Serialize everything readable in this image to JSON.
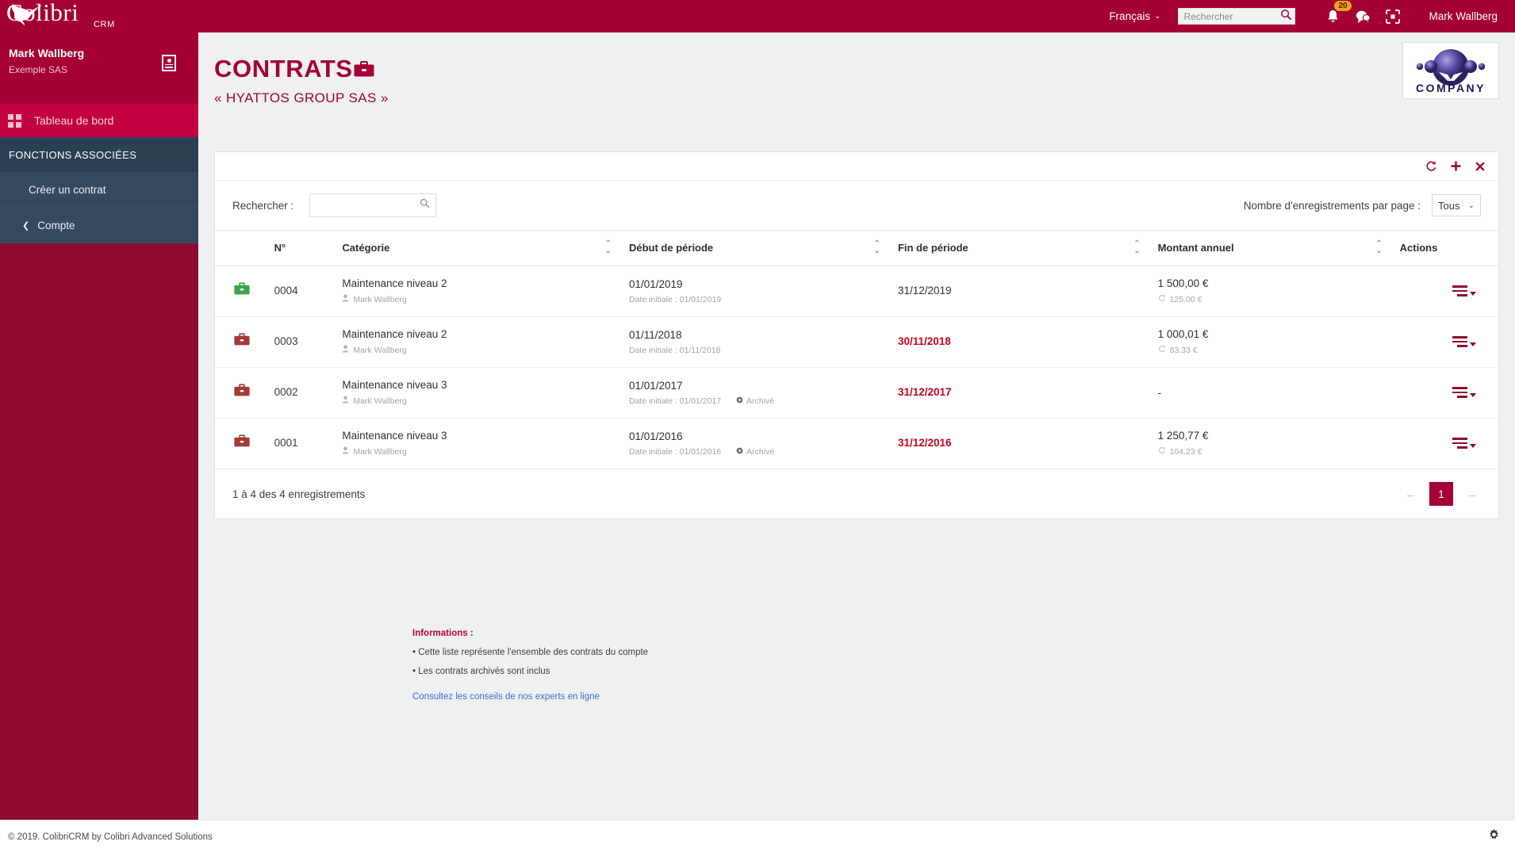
{
  "topbar": {
    "brand_name": "Colibri",
    "brand_sub": "CRM",
    "language": "Français",
    "search_placeholder": "Rechercher",
    "search_value": "",
    "notification_count": "20",
    "user_name": "Mark Wallberg",
    "icons": {
      "bell": "bell-icon",
      "chat": "chat-icon",
      "fullscreen": "fullscreen-icon",
      "search": "search-icon",
      "chevron": "chevron-down-icon"
    }
  },
  "sidebar": {
    "user_name": "Mark Wallberg",
    "user_org": "Exemple SAS",
    "dashboard_label": "Tableau de bord",
    "section_label": "FONCTIONS ASSOCIÉES",
    "items": [
      {
        "label": "Créer un contrat"
      },
      {
        "label": "Compte"
      }
    ]
  },
  "page": {
    "title": "CONTRATS",
    "subtitle": "« HYATTOS GROUP SAS »",
    "logo_text": "COMPANY"
  },
  "toolbar": {
    "refresh_label": "refresh-icon",
    "add_label": "add-icon",
    "close_label": "close-icon"
  },
  "filters": {
    "search_label": "Rechercher :",
    "search_value": "",
    "search_placeholder": "",
    "per_page_label": "Nombre d'enregistrements par page :",
    "per_page_value": "Tous",
    "per_page_options": [
      "Tous"
    ]
  },
  "table": {
    "columns": [
      {
        "key": "icon",
        "label": ""
      },
      {
        "key": "num",
        "label": "N°"
      },
      {
        "key": "category",
        "label": "Catégorie"
      },
      {
        "key": "start",
        "label": "Début de période"
      },
      {
        "key": "end",
        "label": "Fin de période"
      },
      {
        "key": "amount",
        "label": "Montant annuel"
      },
      {
        "key": "actions",
        "label": "Actions"
      }
    ],
    "rows": [
      {
        "icon_color": "#3fa34a",
        "num": "0004",
        "category": "Maintenance niveau 2",
        "owner": "Mark Wallberg",
        "start": "01/01/2019",
        "start_initial": "Date initiale : 01/01/2019",
        "archived": "",
        "end": "31/12/2019",
        "end_expired": false,
        "amount": "1 500,00 €",
        "amount_sub": "125.00 €"
      },
      {
        "icon_color": "#a33a3a",
        "num": "0003",
        "category": "Maintenance niveau 2",
        "owner": "Mark Wallberg",
        "start": "01/11/2018",
        "start_initial": "Date initiale : 01/11/2018",
        "archived": "",
        "end": "30/11/2018",
        "end_expired": true,
        "amount": "1 000,01 €",
        "amount_sub": "83.33 €"
      },
      {
        "icon_color": "#a33a3a",
        "num": "0002",
        "category": "Maintenance niveau 3",
        "owner": "Mark Wallberg",
        "start": "01/01/2017",
        "start_initial": "Date initiale : 01/01/2017",
        "archived": "Archivé",
        "end": "31/12/2017",
        "end_expired": true,
        "amount": "-",
        "amount_sub": ""
      },
      {
        "icon_color": "#a33a3a",
        "num": "0001",
        "category": "Maintenance niveau 3",
        "owner": "Mark Wallberg",
        "start": "01/01/2016",
        "start_initial": "Date initiale : 01/01/2016",
        "archived": "Archivé",
        "end": "31/12/2016",
        "end_expired": true,
        "amount": "1 250,77 €",
        "amount_sub": "104.23 €"
      }
    ]
  },
  "pagination": {
    "count_text": "1 à 4 des 4 enregistrements",
    "prev": "←",
    "page": "1",
    "next": "→"
  },
  "info": {
    "title": "Informations :",
    "lines": [
      "• Cette liste représente l'ensemble des contrats du compte",
      "• Les contrats archivés sont inclus"
    ],
    "link": "Consultez les conseils de nos experts en ligne"
  },
  "footer": {
    "copyright": "© 2019. ColibriCRM by Colibri Advanced Solutions",
    "gear": "gear-icon"
  },
  "colors": {
    "brand": "#a50034",
    "brand_dark": "#8f0b2f",
    "sidebar_section": "#2c4054",
    "sidebar_item": "#33495e",
    "expired_red": "#c5001f",
    "link_blue": "#3f6fd6",
    "badge_orange": "#f0a11a"
  }
}
